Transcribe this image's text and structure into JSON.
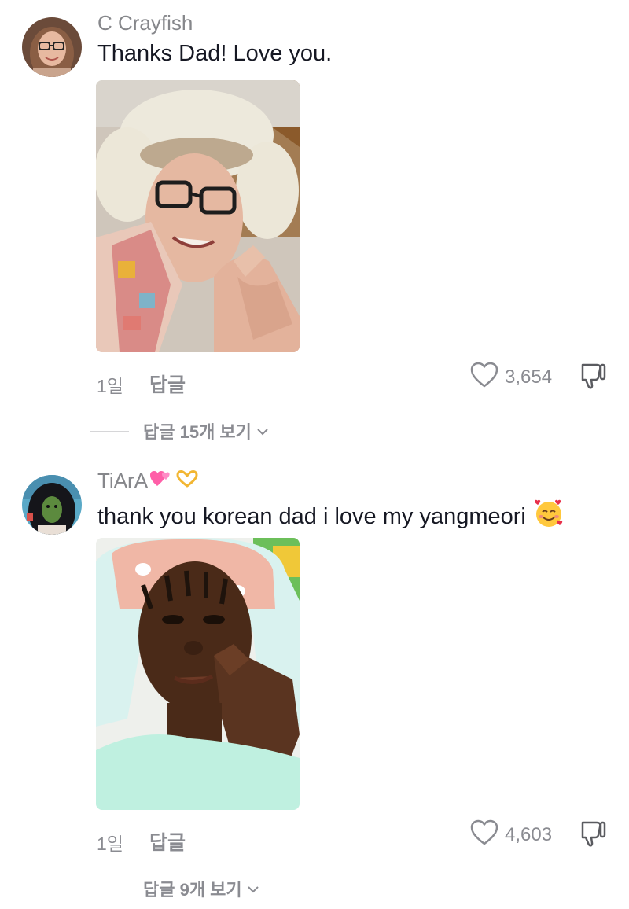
{
  "comments": [
    {
      "username": "C Crayfish",
      "text": "Thanks Dad! Love you.",
      "time": "1일",
      "reply_label": "답글",
      "likes": "3,654",
      "view_replies": "답글 15개 보기"
    },
    {
      "username": "TiArA",
      "username_emojis": [
        "two-hearts-icon",
        "heart-hands-icon"
      ],
      "text": "thank you korean dad i love my yangmeori",
      "text_emoji": "smiling-face-with-hearts-icon",
      "time": "1일",
      "reply_label": "답글",
      "likes": "4,603",
      "view_replies": "답글 9개 보기"
    }
  ],
  "colors": {
    "primary_text": "#161823",
    "secondary_text": "#8a8b91",
    "divider": "#d6d6d8",
    "heart_pink": "#ff5fa8"
  }
}
